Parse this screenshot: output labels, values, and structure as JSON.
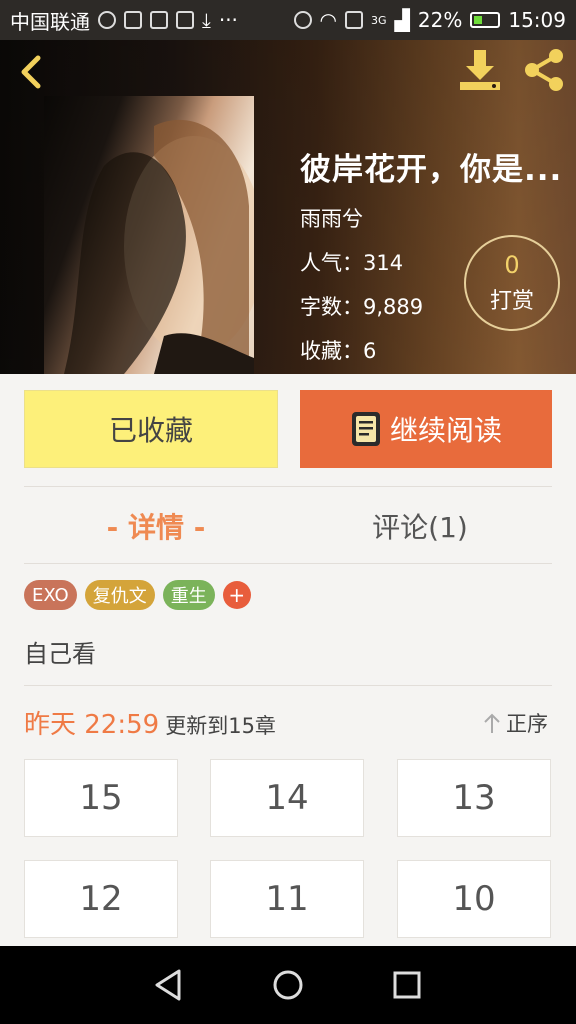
{
  "status_bar": {
    "carrier": "中国联通",
    "network": "3G",
    "battery": "22%",
    "time": "15:09"
  },
  "book": {
    "title": "彼岸花开，你是...",
    "author": "雨雨兮",
    "popularity_label": "人气：",
    "popularity": "314",
    "words_label": "字数：",
    "words": "9,889",
    "favorites_label": "收藏：",
    "favorites": "6",
    "reward_count": "0",
    "reward_label": "打赏"
  },
  "actions": {
    "favorited_label": "已收藏",
    "continue_label": "继续阅读"
  },
  "tabs": {
    "detail": "- 详情 -",
    "comments": "评论(1)"
  },
  "tags": [
    {
      "label": "EXO",
      "color": "#c9745a"
    },
    {
      "label": "复仇文",
      "color": "#d4a43a"
    },
    {
      "label": "重生",
      "color": "#7bb35a"
    }
  ],
  "tag_add": "+",
  "description": "自己看",
  "update": {
    "when": "昨天 22:59",
    "what": "更新到15章",
    "order": "正序"
  },
  "chapters": [
    "15",
    "14",
    "13",
    "12",
    "11",
    "10"
  ],
  "colors": {
    "accent": "#e86b3c",
    "favorite_button": "#fdf07a",
    "tab_active": "#ef8a52"
  }
}
